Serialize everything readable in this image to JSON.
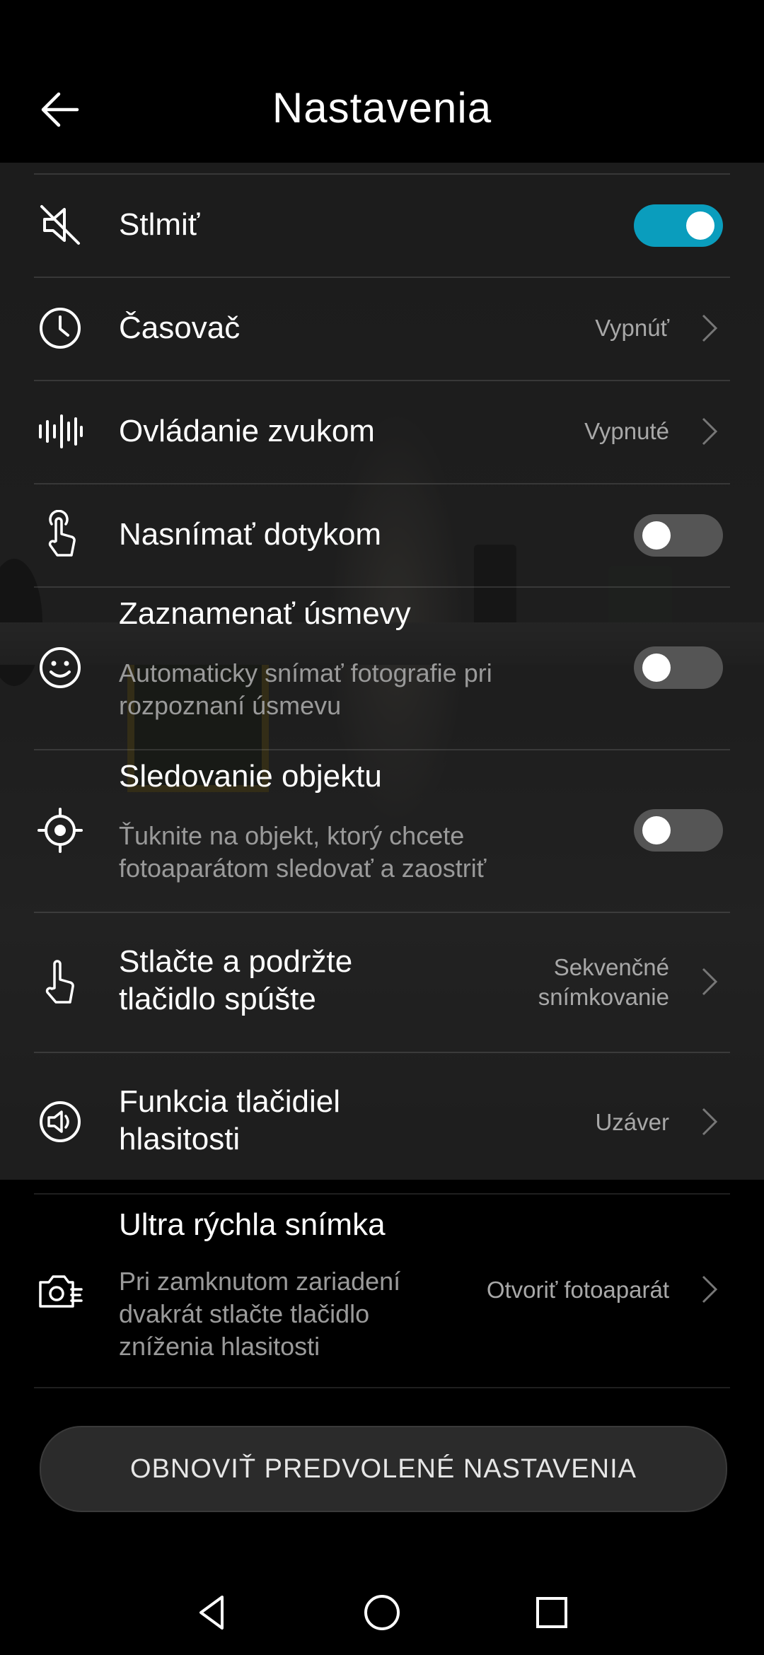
{
  "header": {
    "title": "Nastavenia",
    "back_icon": "arrow-left-icon"
  },
  "settings": [
    {
      "id": "mute",
      "icon": "mute-icon",
      "label": "Stlmiť",
      "control": "toggle",
      "on": true
    },
    {
      "id": "timer",
      "icon": "clock-icon",
      "label": "Časovač",
      "value": "Vypnúť",
      "control": "chevron"
    },
    {
      "id": "audio-control",
      "icon": "sound-wave-icon",
      "label": "Ovládanie zvukom",
      "value": "Vypnuté",
      "control": "chevron"
    },
    {
      "id": "touch-capture",
      "icon": "touch-icon",
      "label": "Nasnímať dotykom",
      "control": "toggle",
      "on": false
    },
    {
      "id": "smile-capture",
      "icon": "smile-icon",
      "label": "Zaznamenať úsmevy",
      "sub_line1": "Automaticky snímať fotografie pri",
      "sub_line2": "rozpoznaní úsmevu",
      "control": "toggle",
      "on": false
    },
    {
      "id": "object-tracking",
      "icon": "target-icon",
      "label": "Sledovanie objektu",
      "sub_line1": "Ťuknite na objekt, ktorý chcete",
      "sub_line2": "fotoaparátom sledovať a zaostriť",
      "control": "toggle",
      "on": false
    },
    {
      "id": "hold-shutter",
      "icon": "hand-pointer-icon",
      "label_line1": "Stlačte a podržte",
      "label_line2": "tlačidlo spúšte",
      "value_line1": "Sekvenčné",
      "value_line2": "snímkovanie",
      "control": "chevron"
    },
    {
      "id": "volume-keys",
      "icon": "speaker-icon",
      "label_line1": "Funkcia tlačidiel",
      "label_line2": "hlasitosti",
      "value": "Uzáver",
      "control": "chevron"
    },
    {
      "id": "ultra-snapshot",
      "icon": "camera-icon",
      "label": "Ultra rýchla snímka",
      "sub_line1": "Pri zamknutom zariadení",
      "sub_line2": "dvakrát stlačte tlačidlo",
      "sub_line3": "zníženia hlasitosti",
      "value": "Otvoriť fotoaparát",
      "control": "chevron"
    }
  ],
  "reset_button": {
    "label": "OBNOVIŤ PREDVOLENÉ NASTAVENIA"
  },
  "navbar": {
    "back": "triangle-back-icon",
    "home": "circle-home-icon",
    "recents": "square-recents-icon"
  },
  "colors": {
    "accent": "#0a9dbd",
    "background": "#000000",
    "secondary_text": "#9a9a9a"
  }
}
